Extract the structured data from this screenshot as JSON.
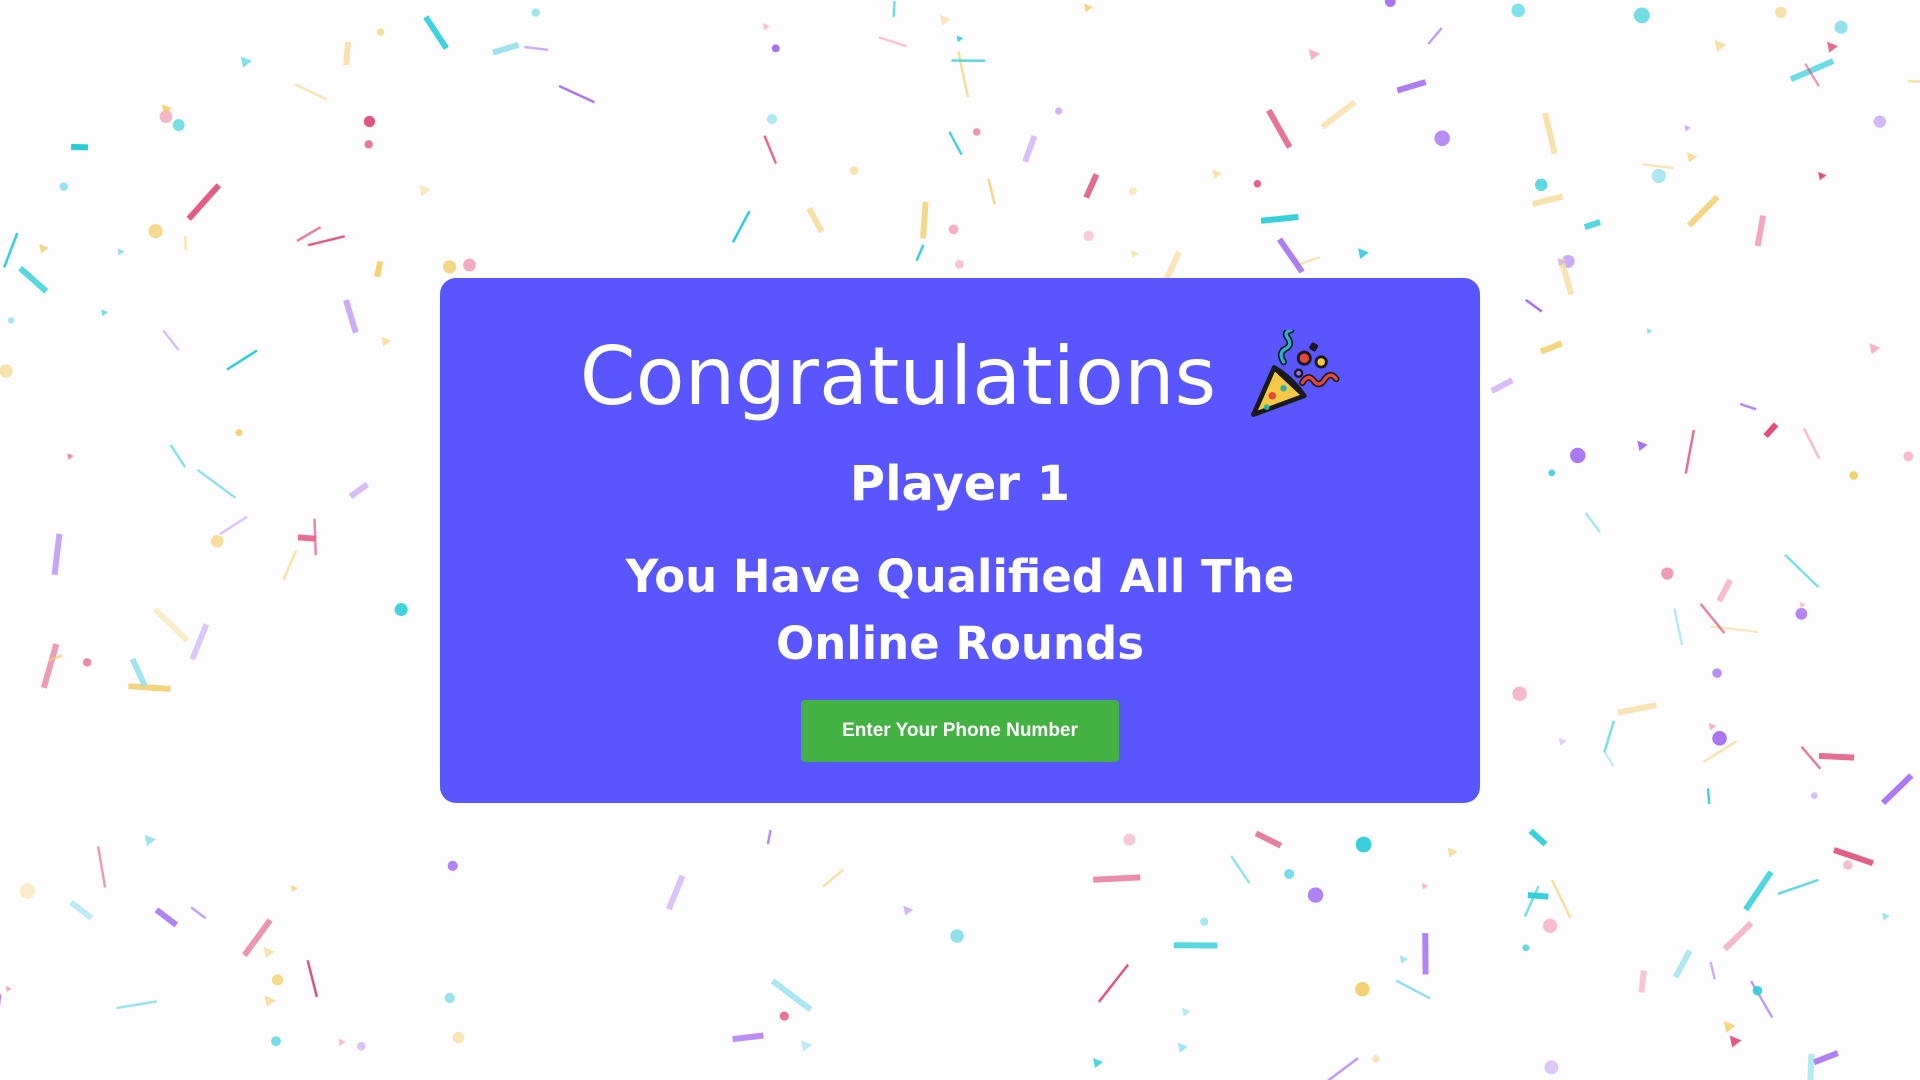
{
  "card": {
    "title": "Congratulations",
    "title_icon": "party-popper-icon",
    "player": "Player 1",
    "message": "You Have Qualified All The Online Rounds",
    "button_label": "Enter Your Phone Number"
  },
  "colors": {
    "card_background": "#5956ff",
    "button_background": "#43b243",
    "text": "#ffffff",
    "confetti": [
      "#26ccd9",
      "#e0507b",
      "#a56ff0",
      "#f2cf6b",
      "#c9a8f4",
      "#f4a5bf",
      "#8fe0ec",
      "#f7e0a5"
    ]
  }
}
